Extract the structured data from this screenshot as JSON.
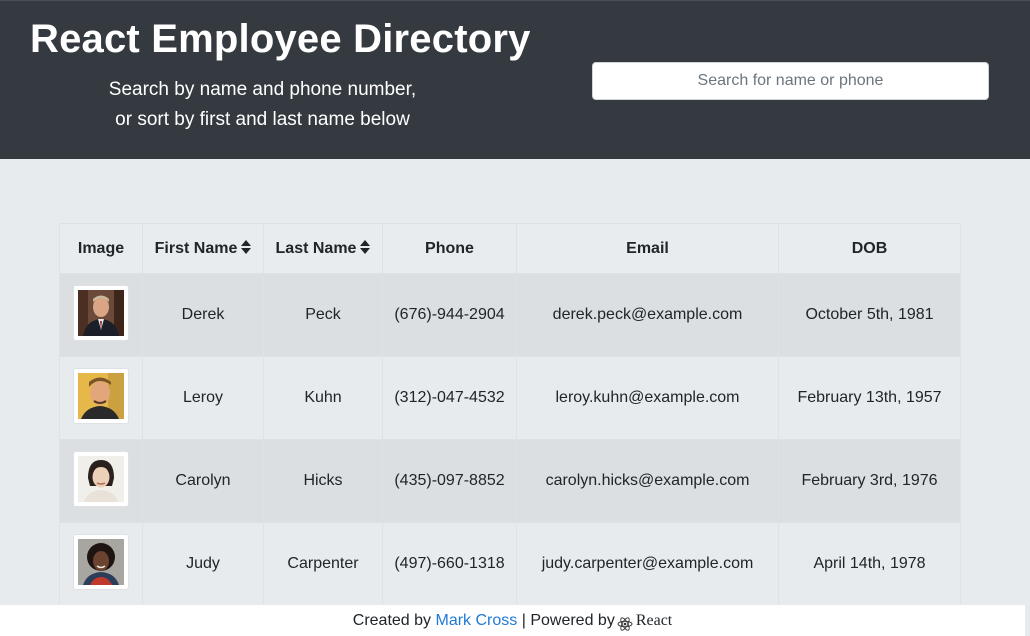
{
  "header": {
    "title": "React Employee Directory",
    "subtitle_line1": "Search by name and phone number,",
    "subtitle_line2": "or sort by first and last name below"
  },
  "search": {
    "placeholder": "Search for name or phone",
    "value": ""
  },
  "table": {
    "columns": [
      "Image",
      "First Name",
      "Last Name",
      "Phone",
      "Email",
      "DOB"
    ],
    "rows": [
      {
        "first": "Derek",
        "last": "Peck",
        "phone": "(676)-944-2904",
        "email": "derek.peck@example.com",
        "dob": "October 5th, 1981"
      },
      {
        "first": "Leroy",
        "last": "Kuhn",
        "phone": "(312)-047-4532",
        "email": "leroy.kuhn@example.com",
        "dob": "February 13th, 1957"
      },
      {
        "first": "Carolyn",
        "last": "Hicks",
        "phone": "(435)-097-8852",
        "email": "carolyn.hicks@example.com",
        "dob": "February 3rd, 1976"
      },
      {
        "first": "Judy",
        "last": "Carpenter",
        "phone": "(497)-660-1318",
        "email": "judy.carpenter@example.com",
        "dob": "April 14th, 1978"
      }
    ]
  },
  "footer": {
    "created_by": "Created by",
    "author": "Mark Cross",
    "separator": "| Powered by",
    "powered": "React"
  },
  "icons": {
    "sort": "sort-icon",
    "react": "react-logo-icon",
    "avatar": "avatar-photo"
  },
  "colors": {
    "header_bg": "#343a40",
    "page_bg": "#e8ebee",
    "row_odd": "#dcdfe2",
    "link": "#1f7ad6"
  }
}
